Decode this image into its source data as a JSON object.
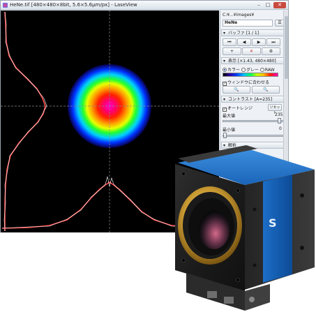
{
  "window": {
    "title": "HeNe.tif [480×480×8bit, 5.6×5.6μm/px] - LaseView",
    "minimize_glyph": "–",
    "maximize_glyph": "□",
    "close_glyph": "✕"
  },
  "panel": {
    "path": "C:¥...¥images¥",
    "file_name": "HeNe",
    "buffer": {
      "header": "バッファ [1 / 1]",
      "nav_buttons": [
        "⏮",
        "◀",
        "▶",
        "⏭"
      ],
      "action_buttons": [
        "+",
        "✕",
        "⚙"
      ]
    },
    "display": {
      "header": "表示 [×1.43, 480×480]",
      "modes": [
        "カラー",
        "グレー",
        "RAW"
      ],
      "selected_mode": "カラー",
      "fit_window_label": "ウィンドウに合わせる",
      "fit_window_checked": true,
      "zoom_in_glyph": "🔍",
      "zoom_out_glyph": "🔍"
    },
    "contrast": {
      "header": "コントラスト [A=235]",
      "auto_range_label": "オートレンジ",
      "auto_range_checked": true,
      "reset_label": "リセット",
      "max_label": "最大値",
      "max_value": "235",
      "min_label": "最小値",
      "min_value": "0"
    },
    "analysis": {
      "header": "解析"
    }
  },
  "colors": {
    "background": "#000000",
    "crosshair": "#9a9a9a",
    "profile_line": "#ffffff",
    "profile_fill": "#ff4d4d"
  }
}
